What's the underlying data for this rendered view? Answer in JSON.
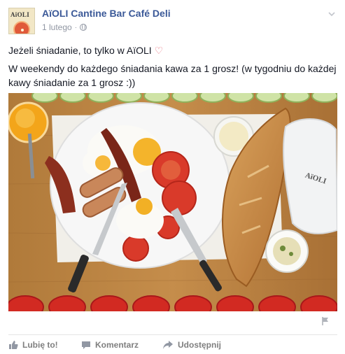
{
  "post": {
    "page_name": "AïOLI Cantine Bar Café Deli",
    "date": "1 lutego",
    "meta_separator": "·",
    "text_line1": "Jeżeli śniadanie, to tylko w AïOLI",
    "text_line2": "W weekendy do każdego śniadania kawa za 1 grosz! (w tygodniu do każdej kawy śniadanie za 1 grosz :))",
    "heart_glyph": "♡"
  },
  "avatar": {
    "logo_text": "AïOLI"
  },
  "photo": {
    "bag_text": "AïOLI"
  },
  "actions": {
    "like_label": "Lubię to!",
    "comment_label": "Komentarz",
    "share_label": "Udostępnij"
  },
  "colors": {
    "page_name": "#3b5998",
    "meta": "#9197a3",
    "heart": "#e86d7b",
    "action_text": "#7f7f7f"
  }
}
